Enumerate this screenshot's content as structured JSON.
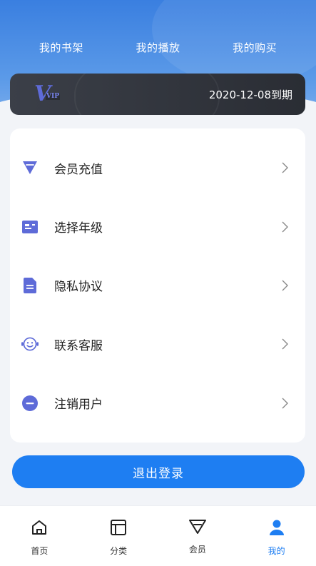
{
  "header": {
    "tabs": [
      "我的书架",
      "我的播放",
      "我的购买"
    ]
  },
  "vip": {
    "logo": "V",
    "logo_sub": "VIP",
    "expire_text": "2020-12-08到期"
  },
  "menu": [
    {
      "label": "会员充值",
      "icon": "diamond-icon"
    },
    {
      "label": "选择年级",
      "icon": "id-card-icon"
    },
    {
      "label": "隐私协议",
      "icon": "document-icon"
    },
    {
      "label": "联系客服",
      "icon": "headset-icon"
    },
    {
      "label": "注销用户",
      "icon": "minus-circle-icon"
    }
  ],
  "logout_label": "退出登录",
  "tabbar": [
    {
      "label": "首页",
      "icon": "home-icon"
    },
    {
      "label": "分类",
      "icon": "category-icon"
    },
    {
      "label": "会员",
      "icon": "vip-diamond-icon"
    },
    {
      "label": "我的",
      "icon": "user-icon",
      "active": true
    }
  ],
  "colors": {
    "accent": "#1e7ef2",
    "icon": "#5e6bd8",
    "hero": "#3a7fe0"
  }
}
